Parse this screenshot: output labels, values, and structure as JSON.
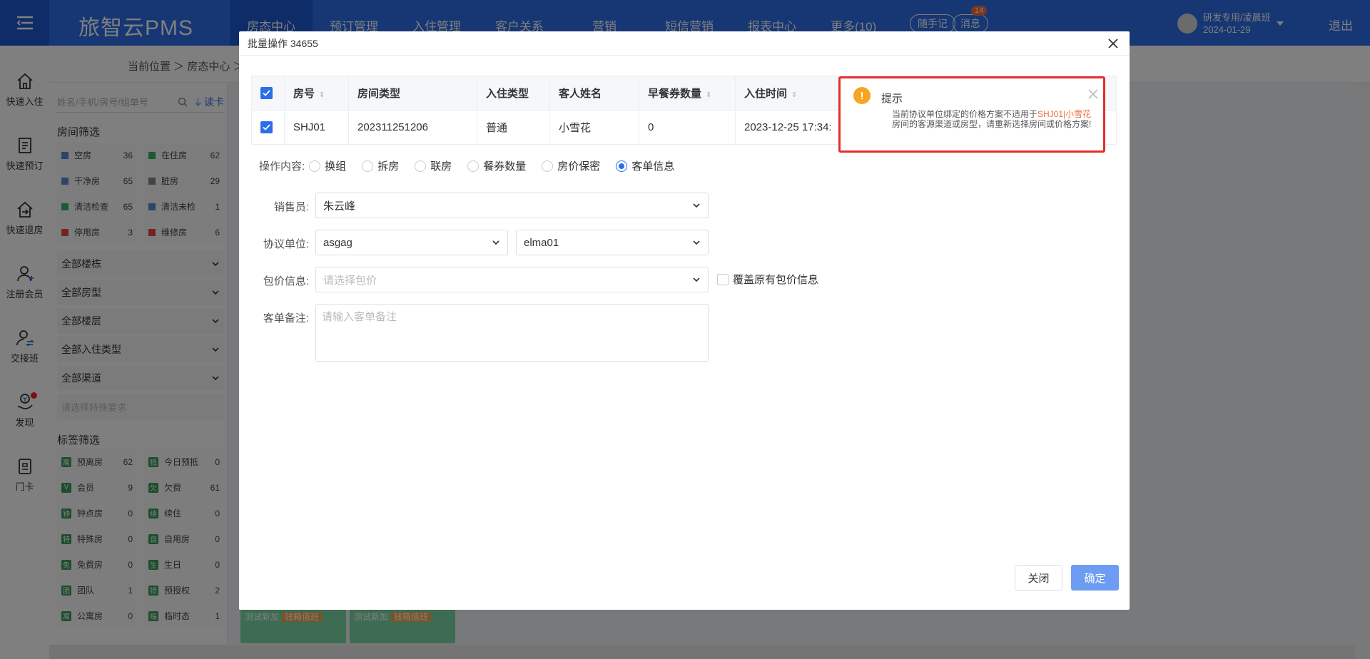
{
  "topbar": {
    "brand": "旅智云PMS",
    "nav": [
      "房态中心",
      "预订管理",
      "入住管理",
      "客户关系",
      "营销",
      "短信营销",
      "报表中心",
      "更多(10)"
    ],
    "memo_btn": "随手记",
    "message_btn": "消息",
    "message_badge": "14",
    "user_name": "研发专用/凌晨班",
    "user_date": "2024-01-29",
    "logout": "退出"
  },
  "rail": [
    {
      "label": "快速入住",
      "icon": "home-icon"
    },
    {
      "label": "快速预订",
      "icon": "booking-icon"
    },
    {
      "label": "快速退房",
      "icon": "checkout-icon"
    },
    {
      "label": "注册会员",
      "icon": "add-user-icon"
    },
    {
      "label": "交接班",
      "icon": "shift-icon"
    },
    {
      "label": "发现",
      "icon": "discover-icon"
    },
    {
      "label": "门卡",
      "icon": "card-icon"
    }
  ],
  "breadcrumb": "当前位置 ＞ 房态中心 ＞",
  "left_panel": {
    "search_placeholder": "姓名/手机/房号/组单号",
    "read_card": "读卡",
    "room_filter_title": "房间筛选",
    "stats": [
      {
        "name": "空房",
        "count": "36",
        "color": "#5b8bd9"
      },
      {
        "name": "在住房",
        "count": "62",
        "color": "#3bb36a"
      },
      {
        "name": "干净房",
        "count": "65",
        "color": "#5b8bd9"
      },
      {
        "name": "脏房",
        "count": "29",
        "color": "#888888"
      },
      {
        "name": "清洁检查",
        "count": "65",
        "color": "#3bb36a"
      },
      {
        "name": "清洁未检",
        "count": "1",
        "color": "#5b8bd9"
      },
      {
        "name": "停用房",
        "count": "3",
        "color": "#e8493e"
      },
      {
        "name": "维修房",
        "count": "6",
        "color": "#e8493e"
      }
    ],
    "dropdowns": [
      "全部楼栋",
      "全部房型",
      "全部楼层",
      "全部入住类型",
      "全部渠道"
    ],
    "special_placeholder": "请选择特殊要求",
    "tag_filter_title": "标签筛选",
    "tags": [
      {
        "name": "预离房",
        "count": "62",
        "glyph": "离"
      },
      {
        "name": "今日预抵",
        "count": "0",
        "glyph": "抵"
      },
      {
        "name": "会员",
        "count": "9",
        "glyph": "V"
      },
      {
        "name": "欠费",
        "count": "61",
        "glyph": "欠"
      },
      {
        "name": "钟点房",
        "count": "0",
        "glyph": "钟"
      },
      {
        "name": "续住",
        "count": "0",
        "glyph": "续"
      },
      {
        "name": "特殊房",
        "count": "0",
        "glyph": "特"
      },
      {
        "name": "自用房",
        "count": "0",
        "glyph": "自"
      },
      {
        "name": "免费房",
        "count": "0",
        "glyph": "免"
      },
      {
        "name": "生日",
        "count": "0",
        "glyph": "生"
      },
      {
        "name": "团队",
        "count": "1",
        "glyph": "团"
      },
      {
        "name": "预授权",
        "count": "2",
        "glyph": "授"
      },
      {
        "name": "公寓房",
        "count": "0",
        "glyph": "寓"
      },
      {
        "name": "临时态",
        "count": "1",
        "glyph": "临"
      }
    ]
  },
  "room_cards": [
    {
      "title": "测试新加",
      "tag": "钱箱值班"
    },
    {
      "title": "测试新加",
      "tag": "钱箱值班"
    }
  ],
  "dialog": {
    "title": "批量操作 34655",
    "table": {
      "headers": [
        "房号",
        "房间类型",
        "入住类型",
        "客人姓名",
        "早餐券数量",
        "入住时间"
      ],
      "rows": [
        [
          "SHJ01",
          "202311251206",
          "普通",
          "小雪花",
          "0",
          "2023-12-25 17:34:"
        ]
      ]
    },
    "op_label": "操作内容:",
    "op_options": [
      "换组",
      "拆房",
      "联房",
      "餐券数量",
      "房价保密",
      "客单信息"
    ],
    "op_selected": 5,
    "sales_label": "销售员:",
    "sales_value": "朱云峰",
    "agreement_label": "协议单位:",
    "agreement_value": "asgag",
    "agreement_sub_value": "elma01",
    "package_label": "包价信息:",
    "package_placeholder": "请选择包价",
    "overwrite_label": "覆盖原有包价信息",
    "remark_label": "客单备注:",
    "remark_placeholder": "请输入客单备注",
    "btn_close": "关闭",
    "btn_ok": "确定"
  },
  "toast": {
    "title": "提示",
    "msg_pre": "当前协议单位绑定的价格方案不适用于",
    "msg_highlight": "SHJ01|小雪花",
    "msg_post": "房间的客源渠道或房型，请重新选择房间或价格方案!",
    "icon_color": "#f5a623",
    "border_color": "#e62b2b"
  }
}
